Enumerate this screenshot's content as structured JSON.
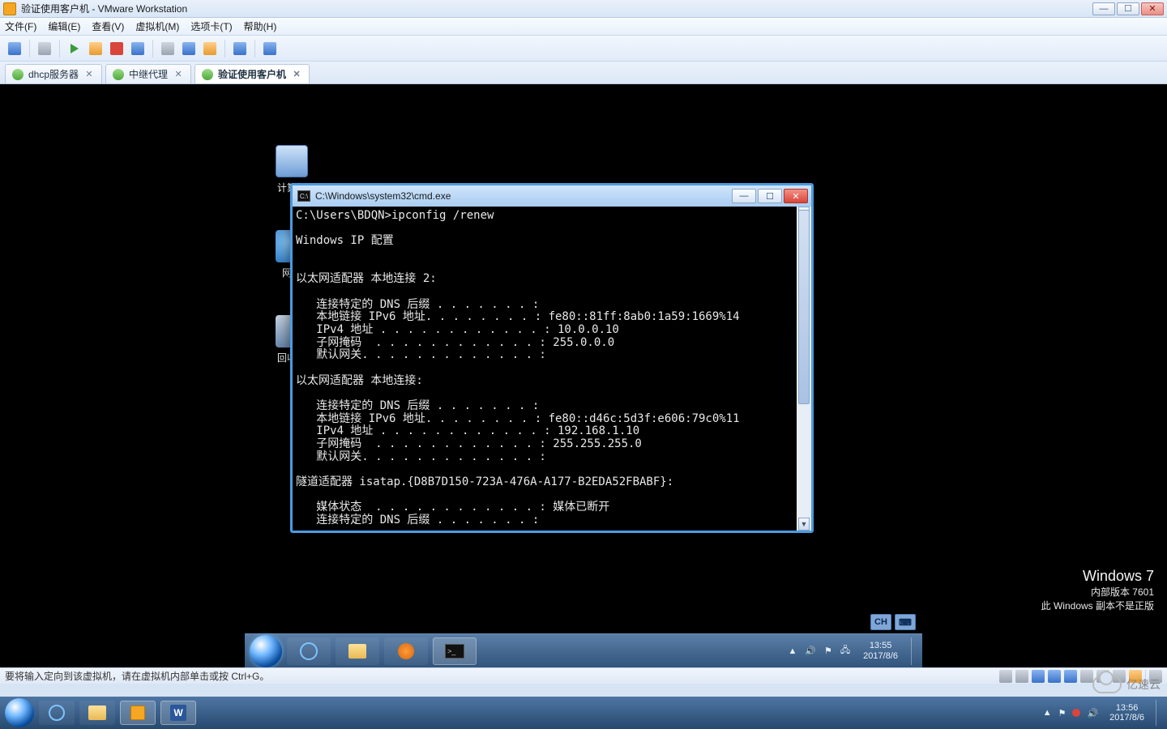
{
  "host": {
    "title": "验证使用客户机 - VMware Workstation",
    "status_text": "要将输入定向到该虚拟机，请在虚拟机内部单击或按 Ctrl+G。",
    "tray_time": "13:56",
    "tray_date": "2017/8/6",
    "watermark_brand": "亿速云"
  },
  "menu": {
    "file": "文件(F)",
    "edit": "编辑(E)",
    "view": "查看(V)",
    "vm": "虚拟机(M)",
    "tabs": "选项卡(T)",
    "help": "帮助(H)"
  },
  "tabs": [
    {
      "label": "dhcp服务器",
      "active": false
    },
    {
      "label": "中继代理",
      "active": false
    },
    {
      "label": "验证使用客户机",
      "active": true
    }
  ],
  "guest": {
    "desktop_icons": {
      "computer": "计算机",
      "network": "网络",
      "recycle": "回收站"
    },
    "taskbar": {
      "lang1": "CH",
      "lang2": "⌨",
      "time": "13:55",
      "date": "2017/8/6"
    },
    "watermark": {
      "line1": "Windows 7",
      "line2": "内部版本 7601",
      "line3": "此 Windows 副本不是正版"
    }
  },
  "cmd": {
    "title": "C:\\Windows\\system32\\cmd.exe",
    "body": "C:\\Users\\BDQN>ipconfig /renew\n\nWindows IP 配置\n\n\n以太网适配器 本地连接 2:\n\n   连接特定的 DNS 后缀 . . . . . . . :\n   本地链接 IPv6 地址. . . . . . . . : fe80::81ff:8ab0:1a59:1669%14\n   IPv4 地址 . . . . . . . . . . . . : 10.0.0.10\n   子网掩码  . . . . . . . . . . . . : 255.0.0.0\n   默认网关. . . . . . . . . . . . . :\n\n以太网适配器 本地连接:\n\n   连接特定的 DNS 后缀 . . . . . . . :\n   本地链接 IPv6 地址. . . . . . . . : fe80::d46c:5d3f:e606:79c0%11\n   IPv4 地址 . . . . . . . . . . . . : 192.168.1.10\n   子网掩码  . . . . . . . . . . . . : 255.255.255.0\n   默认网关. . . . . . . . . . . . . :\n\n隧道适配器 isatap.{D8B7D150-723A-476A-A177-B2EDA52FBABF}:\n\n   媒体状态  . . . . . . . . . . . . : 媒体已断开\n   连接特定的 DNS 后缀 . . . . . . . :"
  }
}
